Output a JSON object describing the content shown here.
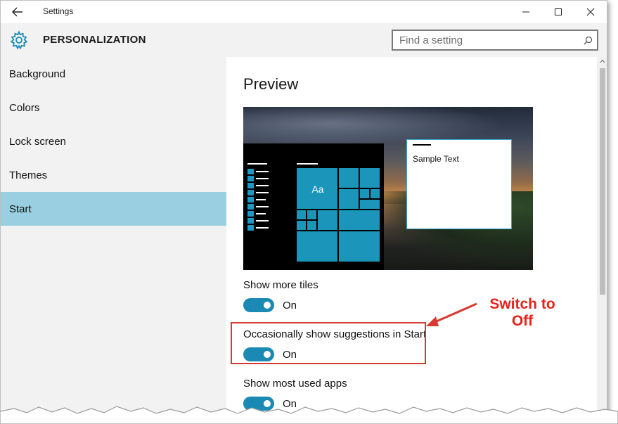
{
  "window": {
    "title": "Settings"
  },
  "header": {
    "section_title": "PERSONALIZATION",
    "search": {
      "placeholder": "Find a setting"
    }
  },
  "sidebar": {
    "items": [
      {
        "label": "Background",
        "selected": false
      },
      {
        "label": "Colors",
        "selected": false
      },
      {
        "label": "Lock screen",
        "selected": false
      },
      {
        "label": "Themes",
        "selected": false
      },
      {
        "label": "Start",
        "selected": true
      }
    ]
  },
  "main": {
    "heading": "Preview",
    "preview": {
      "tile_label": "Aa",
      "sample_text": "Sample Text"
    },
    "settings": [
      {
        "label": "Show more tiles",
        "state": "On"
      },
      {
        "label": "Occasionally show suggestions in Start",
        "state": "On"
      },
      {
        "label": "Show most used apps",
        "state": "On"
      }
    ]
  },
  "annotation": {
    "line1": "Switch to",
    "line2": "Off"
  },
  "colors": {
    "accent": "#1a8ab5",
    "selected_nav": "#99cfe0",
    "annotation": "#e8221c",
    "highlight_border": "#d63a32"
  }
}
